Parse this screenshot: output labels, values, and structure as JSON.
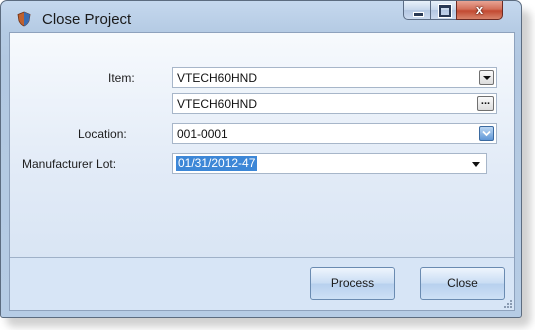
{
  "window": {
    "title": "Close Project",
    "close_glyph": "x"
  },
  "form": {
    "item_label": "Item:",
    "item_value": "VTECH60HND",
    "item_description": "VTECH60HND",
    "ellipsis_label": "...",
    "location_label": "Location:",
    "location_value": "001-0001",
    "lot_label": "Manufacturer Lot:",
    "lot_value": "01/31/2012-47"
  },
  "buttons": {
    "process_label": "Process",
    "close_label": "Close"
  },
  "colors": {
    "selection": "#3d87d7",
    "close_button": "#c24a32"
  }
}
